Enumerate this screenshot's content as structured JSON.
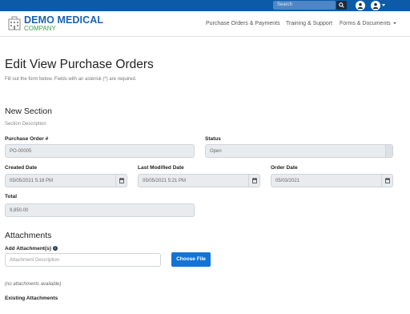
{
  "topbar": {
    "search_placeholder": "Search",
    "search_icon": "search-icon",
    "user_icon": "user-icon",
    "account_icon": "account-icon"
  },
  "brand": {
    "name": "DEMO MEDICAL",
    "sub": "COMPANY",
    "primary_color": "#1b62b0",
    "accent_color": "#3ea24a"
  },
  "nav": {
    "items": [
      {
        "label": "Purchase Orders & Payments"
      },
      {
        "label": "Training & Support"
      },
      {
        "label": "Forms & Documents"
      }
    ]
  },
  "page": {
    "title": "Edit View Purchase Orders",
    "description": "Fill out the form below. Fields with an asterisk (*) are required."
  },
  "section": {
    "title": "New Section",
    "description": "Section Description"
  },
  "fields": {
    "purchase_order": {
      "label": "Purchase Order #",
      "value": "PO-00005"
    },
    "status": {
      "label": "Status",
      "value": "Open"
    },
    "created_date": {
      "label": "Created Date",
      "value": "05/05/2021 5:18 PM"
    },
    "last_modified_date": {
      "label": "Last Modified Date",
      "value": "05/05/2021 5:21 PM"
    },
    "order_date": {
      "label": "Order Date",
      "value": "05/03/2021"
    },
    "total": {
      "label": "Total",
      "value": "9,850.00"
    }
  },
  "attachments": {
    "title": "Attachments",
    "add_label": "Add Attachment(s)",
    "info_glyph": "i",
    "description_placeholder": "Attachment Description",
    "choose_file_label": "Choose File",
    "button_color": "#1374d6",
    "empty_text": "(no attachments available)",
    "existing_label": "Existing Attachments"
  }
}
